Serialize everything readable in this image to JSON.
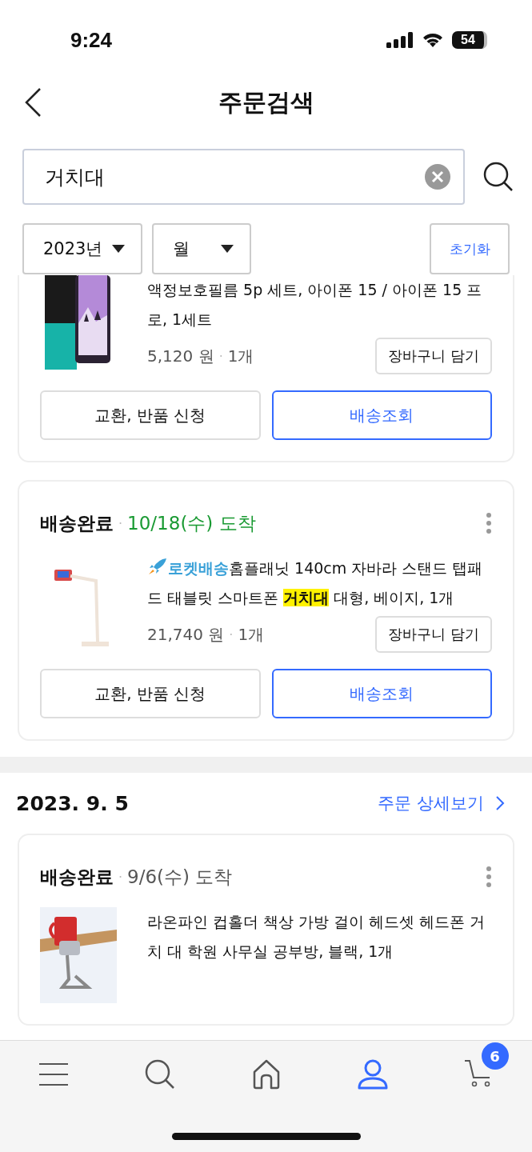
{
  "status_bar": {
    "time": "9:24",
    "battery": "54"
  },
  "header": {
    "title": "주문검색"
  },
  "search": {
    "value": "거치대"
  },
  "filters": {
    "year": "2023년",
    "month": "월",
    "reset": "초기화"
  },
  "orders": [
    {
      "items": [
        {
          "title": [
            {
              "text": "액정보호필름 5p 세트, 아이폰 15 / 아이폰 15 프로, 1세트",
              "highlight": false
            }
          ],
          "price": "5,120 원",
          "separator": "·",
          "qty": "1개",
          "cart": "장바구니 담기",
          "exchange": "교환, 반품 신청",
          "track": "배송조회"
        },
        {
          "status": "배송완료",
          "status_separator": "·",
          "arrival": "10/18(수) 도착",
          "arrival_highlight": true,
          "badge": "로켓배송",
          "title": [
            {
              "text": "홈플래닛 140cm 자바라 스탠드 탭패드 태블릿 스마트폰 ",
              "highlight": false
            },
            {
              "text": "거치대",
              "highlight": true
            },
            {
              "text": " 대형, 베이지, 1개",
              "highlight": false
            }
          ],
          "price": "21,740 원",
          "separator": "·",
          "qty": "1개",
          "cart": "장바구니 담기",
          "exchange": "교환, 반품 신청",
          "track": "배송조회"
        }
      ]
    },
    {
      "date": "2023. 9. 5",
      "detail_link": "주문 상세보기",
      "items": [
        {
          "status": "배송완료",
          "status_separator": "·",
          "arrival": "9/6(수) 도착",
          "arrival_highlight": false,
          "title": [
            {
              "text": "라온파인 컵홀더 책상 가방 걸이 헤드셋 헤드폰 거치 대 학원 사무실 공부방, 블랙, 1개",
              "highlight": false
            }
          ]
        }
      ]
    }
  ],
  "tab_bar": [
    {
      "kind": "menu",
      "selected": false
    },
    {
      "kind": "search",
      "selected": false
    },
    {
      "kind": "home",
      "selected": false
    },
    {
      "kind": "account",
      "selected": true
    },
    {
      "kind": "cart",
      "selected": false,
      "badge": "6"
    }
  ]
}
